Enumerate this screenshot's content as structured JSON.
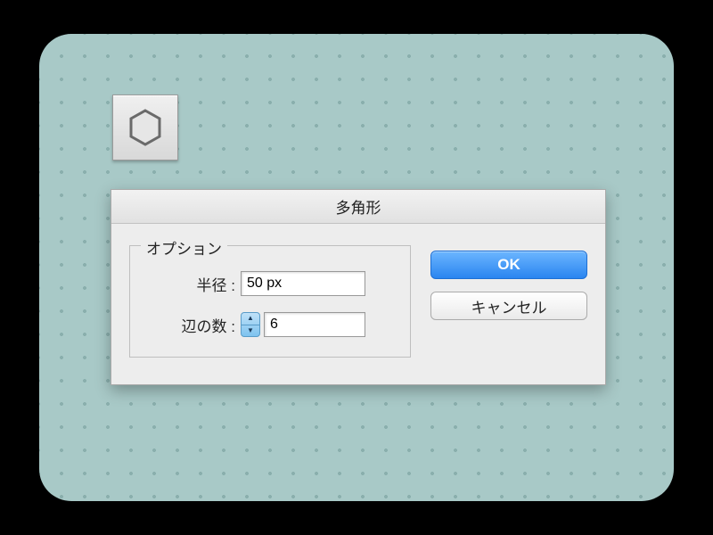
{
  "dialog": {
    "title": "多角形",
    "options_legend": "オプション",
    "radius_label": "半径 :",
    "radius_value": "50 px",
    "sides_label": "辺の数 :",
    "sides_value": "6"
  },
  "buttons": {
    "ok": "OK",
    "cancel": "キャンセル"
  },
  "tool": {
    "name": "polygon"
  }
}
